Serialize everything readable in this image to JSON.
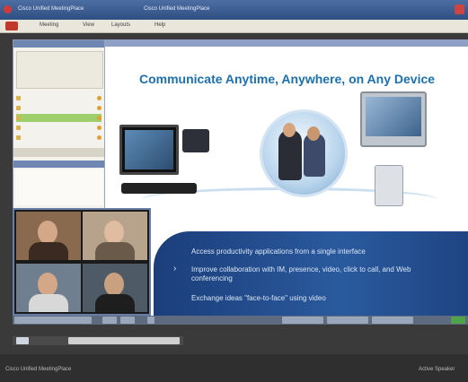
{
  "window": {
    "title": "Cisco Unified MeetingPlace",
    "tab": "Cisco Unified MeetingPlace"
  },
  "menu": {
    "items": [
      "Meeting",
      "View",
      "Layouts",
      "Help"
    ]
  },
  "slide": {
    "title": "Communicate Anytime, Anywhere, on Any Device",
    "bullets": [
      "Access productivity applications from a single interface",
      "Improve collaboration with IM, presence, video, click to call, and Web conferencing",
      "Exchange ideas \"face-to-face\" using video"
    ]
  },
  "status_bar": {
    "left": "Cisco Unified MeetingPlace",
    "right": "Active Speaker"
  },
  "colors": {
    "accent": "#1d6fae",
    "band": "#2a5a9e",
    "titlebar": "#2f4f82"
  }
}
